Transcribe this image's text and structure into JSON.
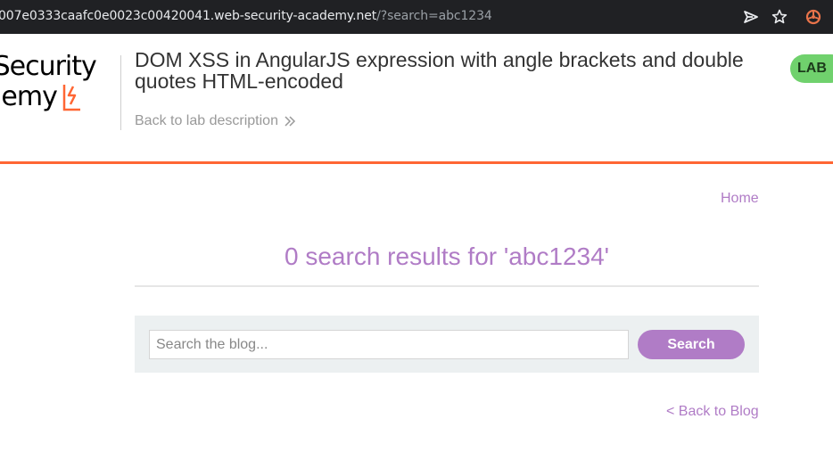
{
  "browser": {
    "url_host": "007e0333caafc0e0023c00420041.web-security-academy.net",
    "url_query": "/?search=abc1234",
    "icons": [
      "send-icon",
      "star-icon",
      "extension-icon"
    ]
  },
  "header": {
    "logo_line1": "b Security",
    "logo_line2": "ademy",
    "title": "DOM XSS in AngularJS expression with angle brackets and double quotes HTML-encoded",
    "back_link": "Back to lab description",
    "badge": "LAB"
  },
  "colors": {
    "accent_orange": "#ff6633",
    "link_purple": "#b07cc6",
    "badge_green": "#70d16d",
    "search_panel": "#ecf0f1"
  },
  "nav": {
    "home": "Home"
  },
  "results": {
    "title": "0 search results for 'abc1234'"
  },
  "search": {
    "placeholder": "Search the blog...",
    "value": "",
    "button": "Search"
  },
  "footer": {
    "back_to_blog": "< Back to Blog"
  }
}
